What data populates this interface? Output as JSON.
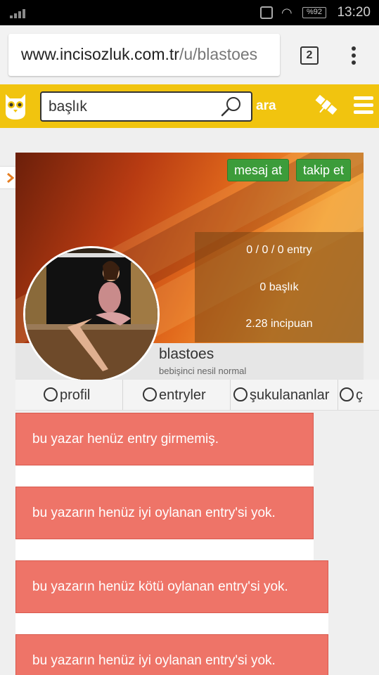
{
  "status_bar": {
    "time": "13:20",
    "battery": "%92"
  },
  "browser": {
    "url_host": "www.incisozluk.com.tr",
    "url_path": "/u/blastoes",
    "tab_count": "2"
  },
  "header": {
    "search_placeholder": "başlık",
    "search_button": "ara"
  },
  "profile": {
    "message_button": "mesaj at",
    "follow_button": "takip et",
    "stats": {
      "entries": "0 / 0 / 0 entry",
      "titles": "0 başlık",
      "points": "2.28 incipuan"
    },
    "username": "blastoes",
    "rank": "bebişinci nesil normal"
  },
  "tabs": [
    {
      "label": "profil"
    },
    {
      "label": "entryler"
    },
    {
      "label": "şukulananlar"
    },
    {
      "label": "ç"
    }
  ],
  "notices": [
    "bu yazar henüz entry girmemiş.",
    "bu yazarın henüz iyi oylanan entry'si yok.",
    "bu yazarın henüz kötü oylanan entry'si yok.",
    "bu yazarın henüz iyi oylanan entry'si yok."
  ],
  "colors": {
    "header": "#f1c40f",
    "green_button": "#3c9c3a",
    "notice": "#ee7468"
  }
}
